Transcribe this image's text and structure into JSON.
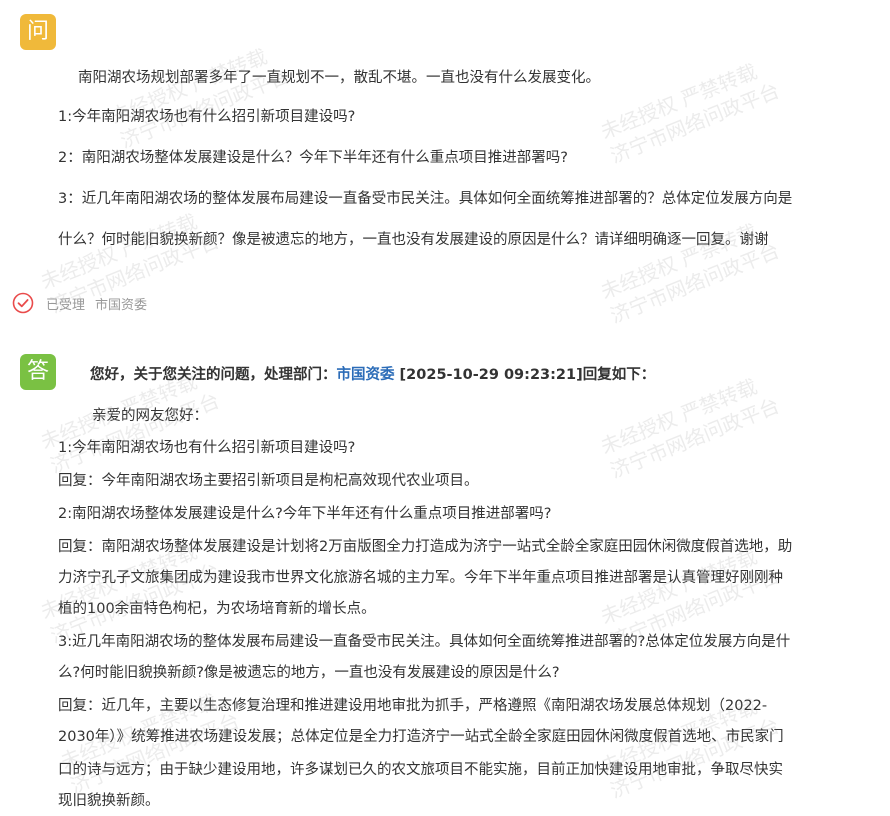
{
  "question": {
    "badge": "问",
    "intro": "南阳湖农场规划部署多年了一直规划不一，散乱不堪。一直也没有什么发展变化。",
    "q1": "1:今年南阳湖农场也有什么招引新项目建设吗?",
    "q2": "2：南阳湖农场整体发展建设是什么？今年下半年还有什么重点项目推进部署吗?",
    "q3_line1": "3：近几年南阳湖农场的整体发展布局建设一直备受市民关注。具体如何全面统筹推进部署的？总体定位发展方向是",
    "q3_line2": "什么？何时能旧貌换新颜？像是被遗忘的地方，一直也没有发展建设的原因是什么？请详细明确逐一回复。谢谢"
  },
  "status": {
    "text": "已受理",
    "dept": "市国资委",
    "color": "#e94b4b"
  },
  "answer": {
    "badge": "答",
    "head_prefix": "您好，关于您关注的问题，处理部门：",
    "head_dept": "市国资委",
    "head_time": " [2025-10-29 09:23:21]回复如下：",
    "greeting": "亲爱的网友您好：",
    "q1": "1:今年南阳湖农场也有什么招引新项目建设吗?",
    "r1": "回复：今年南阳湖农场主要招引新项目是枸杞高效现代农业项目。",
    "q2": "2:南阳湖农场整体发展建设是什么?今年下半年还有什么重点项目推进部署吗?",
    "r2_line1": "回复：南阳湖农场整体发展建设是计划将2万亩版图全力打造成为济宁一站式全龄全家庭田园休闲微度假首选地，助",
    "r2_line2": "力济宁孔子文旅集团成为建设我市世界文化旅游名城的主力军。今年下半年重点项目推进部署是认真管理好刚刚种",
    "r2_line3": "植的100余亩特色枸杞，为农场培育新的增长点。",
    "q3_line1": "3:近几年南阳湖农场的整体发展布局建设一直备受市民关注。具体如何全面统筹推进部署的?总体定位发展方向是什",
    "q3_line2": "么?何时能旧貌换新颜?像是被遗忘的地方，一直也没有发展建设的原因是什么?",
    "r3_line1": "回复：近几年，主要以生态修复治理和推进建设用地审批为抓手，严格遵照《南阳湖农场发展总体规划（2022-",
    "r3_line2": "2030年）》统筹推进农场建设发展；总体定位是全力打造济宁一站式全龄全家庭田园休闲微度假首选地、市民家门",
    "r3_line3": "口的诗与远方；由于缺少建设用地，许多谋划已久的农文旅项目不能实施，目前正加快建设用地审批，争取尽快实",
    "r3_line4": "现旧貌换新颜。"
  },
  "watermark": {
    "line1": "未经授权  严禁转载",
    "line2": "济宁市网络问政平台"
  },
  "colors": {
    "question_badge": "#f0b93a",
    "answer_badge": "#7ac143",
    "dept_link": "#2b6cb8"
  }
}
